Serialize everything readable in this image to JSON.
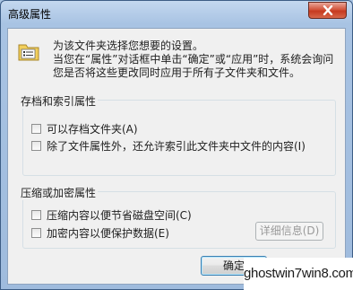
{
  "window": {
    "title": "高级属性",
    "close_icon": "close-icon"
  },
  "description": {
    "line1": "为该文件夹选择您想要的设置。",
    "line2": "当您在“属性”对话框中单击“确定”或“应用”时，系统会询问您是否将这些更改同时应用于所有子文件夹和文件。",
    "icon": "folder-properties-icon"
  },
  "archive_group": {
    "title": "存档和索引属性",
    "options": [
      {
        "label": "可以存档文件夹(A)",
        "checked": false
      },
      {
        "label": "除了文件属性外，还允许索引此文件夹中文件的内容(I)",
        "checked": false
      }
    ]
  },
  "compress_group": {
    "title": "压缩或加密属性",
    "options": [
      {
        "label": "压缩内容以便节省磁盘空间(C)",
        "checked": false
      },
      {
        "label": "加密内容以便保护数据(E)",
        "checked": false
      }
    ],
    "details_button": "详细信息(D)"
  },
  "buttons": {
    "ok": "确定"
  },
  "watermark": "ghostwin7win8.com"
}
